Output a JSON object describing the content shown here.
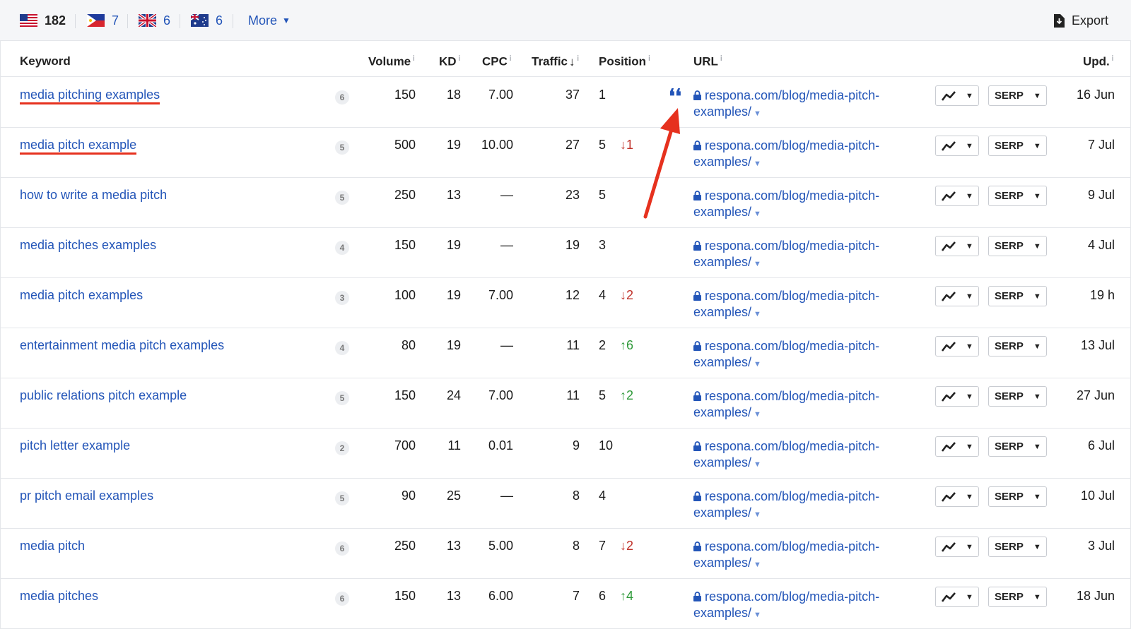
{
  "countries": [
    {
      "code": "US",
      "count": "182"
    },
    {
      "code": "PH",
      "count": "7"
    },
    {
      "code": "GB",
      "count": "6"
    },
    {
      "code": "AU",
      "count": "6"
    }
  ],
  "toolbar": {
    "more_label": "More",
    "export_label": "Export"
  },
  "columns": {
    "keyword": "Keyword",
    "volume": "Volume",
    "kd": "KD",
    "cpc": "CPC",
    "traffic": "Traffic",
    "position": "Position",
    "url": "URL",
    "updated": "Upd.",
    "info": "i"
  },
  "url_text": "respona.com/blog/media-pitch-examples/",
  "serp_label": "SERP",
  "rows": [
    {
      "keyword": "media pitching examples",
      "words": "6",
      "volume": "150",
      "kd": "18",
      "cpc": "7.00",
      "traffic": "37",
      "position": "1",
      "change": "",
      "change_dir": "",
      "upd": "16 Jun"
    },
    {
      "keyword": "media pitch example",
      "words": "5",
      "volume": "500",
      "kd": "19",
      "cpc": "10.00",
      "traffic": "27",
      "position": "5",
      "change": "1",
      "change_dir": "down",
      "upd": "7 Jul"
    },
    {
      "keyword": "how to write a media pitch",
      "words": "5",
      "volume": "250",
      "kd": "13",
      "cpc": "—",
      "traffic": "23",
      "position": "5",
      "change": "",
      "change_dir": "",
      "upd": "9 Jul"
    },
    {
      "keyword": "media pitches examples",
      "words": "4",
      "volume": "150",
      "kd": "19",
      "cpc": "—",
      "traffic": "19",
      "position": "3",
      "change": "",
      "change_dir": "",
      "upd": "4 Jul"
    },
    {
      "keyword": "media pitch examples",
      "words": "3",
      "volume": "100",
      "kd": "19",
      "cpc": "7.00",
      "traffic": "12",
      "position": "4",
      "change": "2",
      "change_dir": "down",
      "upd": "19 h"
    },
    {
      "keyword": "entertainment media pitch examples",
      "words": "4",
      "volume": "80",
      "kd": "19",
      "cpc": "—",
      "traffic": "11",
      "position": "2",
      "change": "6",
      "change_dir": "up",
      "upd": "13 Jul"
    },
    {
      "keyword": "public relations pitch example",
      "words": "5",
      "volume": "150",
      "kd": "24",
      "cpc": "7.00",
      "traffic": "11",
      "position": "5",
      "change": "2",
      "change_dir": "up",
      "upd": "27 Jun"
    },
    {
      "keyword": "pitch letter example",
      "words": "2",
      "volume": "700",
      "kd": "11",
      "cpc": "0.01",
      "traffic": "9",
      "position": "10",
      "change": "",
      "change_dir": "",
      "upd": "6 Jul"
    },
    {
      "keyword": "pr pitch email examples",
      "words": "5",
      "volume": "90",
      "kd": "25",
      "cpc": "—",
      "traffic": "8",
      "position": "4",
      "change": "",
      "change_dir": "",
      "upd": "10 Jul"
    },
    {
      "keyword": "media pitch",
      "words": "6",
      "volume": "250",
      "kd": "13",
      "cpc": "5.00",
      "traffic": "8",
      "position": "7",
      "change": "2",
      "change_dir": "down",
      "upd": "3 Jul"
    },
    {
      "keyword": "media pitches",
      "words": "6",
      "volume": "150",
      "kd": "13",
      "cpc": "6.00",
      "traffic": "7",
      "position": "6",
      "change": "4",
      "change_dir": "up",
      "upd": "18 Jun"
    }
  ],
  "highlight_rows": [
    0,
    1
  ],
  "featured_snippet_row": 0,
  "colors": {
    "link": "#2355b8",
    "annotation": "#e6311e",
    "down": "#c0322a",
    "up": "#2f9a3a"
  }
}
